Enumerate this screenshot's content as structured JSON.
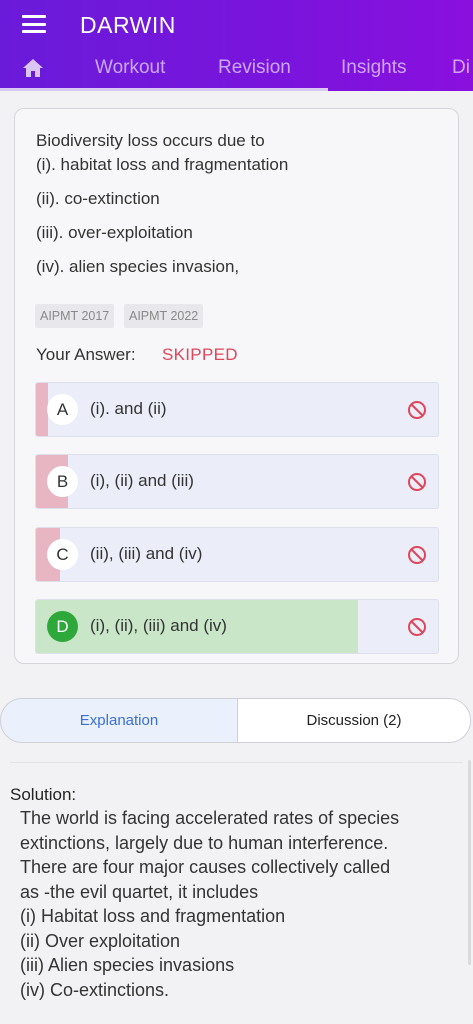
{
  "app": {
    "title": "DARWIN"
  },
  "tabs": [
    "Workout",
    "Revision",
    "Insights",
    "Di"
  ],
  "question": {
    "lines": [
      "Biodiversity loss occurs due to",
      "(i). habitat loss and fragmentation",
      "(ii). co-extinction",
      "(iii). over-exploitation",
      "(iv). alien species invasion,"
    ],
    "tags": [
      "AIPMT 2017",
      "AIPMT 2022"
    ],
    "your_answer_label": "Your Answer:",
    "your_answer_value": "SKIPPED"
  },
  "options": [
    {
      "letter": "A",
      "text": "(i). and (ii)",
      "correct": false,
      "response_share": 0.03
    },
    {
      "letter": "B",
      "text": "(i), (ii) and (iii)",
      "correct": false,
      "response_share": 0.08
    },
    {
      "letter": "C",
      "text": "(ii), (iii) and (iv)",
      "correct": false,
      "response_share": 0.06
    },
    {
      "letter": "D",
      "text": "(i), (ii), (iii) and (iv)",
      "correct": true,
      "response_share": 0.8
    }
  ],
  "colors": {
    "primary": "#7614dc",
    "skipped": "#e0455a",
    "wrong_fill": "#e8b6c2",
    "correct_fill": "#c9e6c9",
    "correct_badge": "#2ea83a",
    "accent_blue": "#3a6fd8"
  },
  "icons": {
    "menu": "menu-icon",
    "home": "home-icon",
    "option_status": "ban-icon"
  },
  "segments": {
    "explanation": "Explanation",
    "discussion": "Discussion (2)"
  },
  "solution": {
    "label": "Solution:",
    "lines": [
      "The world is facing accelerated rates of species",
      "extinctions, largely due to human interference.",
      "There are four major causes collectively called",
      "as -the evil quartet, it includes",
      "(i) Habitat loss and fragmentation",
      "(ii) Over exploitation",
      "(iii) Alien species invasions",
      "(iv) Co-extinctions."
    ]
  }
}
